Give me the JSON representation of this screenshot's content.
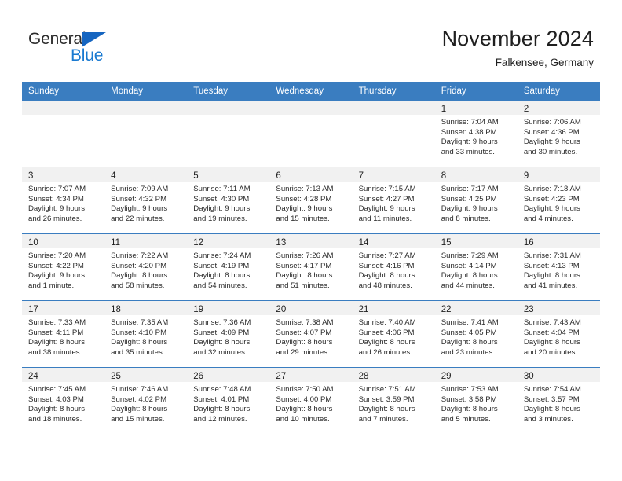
{
  "brand": {
    "name_part1": "General",
    "name_part2": "Blue",
    "accent_color": "#1a7ad1",
    "triangle_color": "#1565c0"
  },
  "header": {
    "month_title": "November 2024",
    "location": "Falkensee, Germany",
    "header_bg_color": "#3a7dc0"
  },
  "weekday_headers": [
    "Sunday",
    "Monday",
    "Tuesday",
    "Wednesday",
    "Thursday",
    "Friday",
    "Saturday"
  ],
  "weeks": [
    [
      {
        "day": "",
        "sunrise": "",
        "sunset": "",
        "daylight_line1": "",
        "daylight_line2": "",
        "empty": true
      },
      {
        "day": "",
        "sunrise": "",
        "sunset": "",
        "daylight_line1": "",
        "daylight_line2": "",
        "empty": true
      },
      {
        "day": "",
        "sunrise": "",
        "sunset": "",
        "daylight_line1": "",
        "daylight_line2": "",
        "empty": true
      },
      {
        "day": "",
        "sunrise": "",
        "sunset": "",
        "daylight_line1": "",
        "daylight_line2": "",
        "empty": true
      },
      {
        "day": "",
        "sunrise": "",
        "sunset": "",
        "daylight_line1": "",
        "daylight_line2": "",
        "empty": true
      },
      {
        "day": "1",
        "sunrise": "Sunrise: 7:04 AM",
        "sunset": "Sunset: 4:38 PM",
        "daylight_line1": "Daylight: 9 hours",
        "daylight_line2": "and 33 minutes.",
        "empty": false
      },
      {
        "day": "2",
        "sunrise": "Sunrise: 7:06 AM",
        "sunset": "Sunset: 4:36 PM",
        "daylight_line1": "Daylight: 9 hours",
        "daylight_line2": "and 30 minutes.",
        "empty": false
      }
    ],
    [
      {
        "day": "3",
        "sunrise": "Sunrise: 7:07 AM",
        "sunset": "Sunset: 4:34 PM",
        "daylight_line1": "Daylight: 9 hours",
        "daylight_line2": "and 26 minutes.",
        "empty": false
      },
      {
        "day": "4",
        "sunrise": "Sunrise: 7:09 AM",
        "sunset": "Sunset: 4:32 PM",
        "daylight_line1": "Daylight: 9 hours",
        "daylight_line2": "and 22 minutes.",
        "empty": false
      },
      {
        "day": "5",
        "sunrise": "Sunrise: 7:11 AM",
        "sunset": "Sunset: 4:30 PM",
        "daylight_line1": "Daylight: 9 hours",
        "daylight_line2": "and 19 minutes.",
        "empty": false
      },
      {
        "day": "6",
        "sunrise": "Sunrise: 7:13 AM",
        "sunset": "Sunset: 4:28 PM",
        "daylight_line1": "Daylight: 9 hours",
        "daylight_line2": "and 15 minutes.",
        "empty": false
      },
      {
        "day": "7",
        "sunrise": "Sunrise: 7:15 AM",
        "sunset": "Sunset: 4:27 PM",
        "daylight_line1": "Daylight: 9 hours",
        "daylight_line2": "and 11 minutes.",
        "empty": false
      },
      {
        "day": "8",
        "sunrise": "Sunrise: 7:17 AM",
        "sunset": "Sunset: 4:25 PM",
        "daylight_line1": "Daylight: 9 hours",
        "daylight_line2": "and 8 minutes.",
        "empty": false
      },
      {
        "day": "9",
        "sunrise": "Sunrise: 7:18 AM",
        "sunset": "Sunset: 4:23 PM",
        "daylight_line1": "Daylight: 9 hours",
        "daylight_line2": "and 4 minutes.",
        "empty": false
      }
    ],
    [
      {
        "day": "10",
        "sunrise": "Sunrise: 7:20 AM",
        "sunset": "Sunset: 4:22 PM",
        "daylight_line1": "Daylight: 9 hours",
        "daylight_line2": "and 1 minute.",
        "empty": false
      },
      {
        "day": "11",
        "sunrise": "Sunrise: 7:22 AM",
        "sunset": "Sunset: 4:20 PM",
        "daylight_line1": "Daylight: 8 hours",
        "daylight_line2": "and 58 minutes.",
        "empty": false
      },
      {
        "day": "12",
        "sunrise": "Sunrise: 7:24 AM",
        "sunset": "Sunset: 4:19 PM",
        "daylight_line1": "Daylight: 8 hours",
        "daylight_line2": "and 54 minutes.",
        "empty": false
      },
      {
        "day": "13",
        "sunrise": "Sunrise: 7:26 AM",
        "sunset": "Sunset: 4:17 PM",
        "daylight_line1": "Daylight: 8 hours",
        "daylight_line2": "and 51 minutes.",
        "empty": false
      },
      {
        "day": "14",
        "sunrise": "Sunrise: 7:27 AM",
        "sunset": "Sunset: 4:16 PM",
        "daylight_line1": "Daylight: 8 hours",
        "daylight_line2": "and 48 minutes.",
        "empty": false
      },
      {
        "day": "15",
        "sunrise": "Sunrise: 7:29 AM",
        "sunset": "Sunset: 4:14 PM",
        "daylight_line1": "Daylight: 8 hours",
        "daylight_line2": "and 44 minutes.",
        "empty": false
      },
      {
        "day": "16",
        "sunrise": "Sunrise: 7:31 AM",
        "sunset": "Sunset: 4:13 PM",
        "daylight_line1": "Daylight: 8 hours",
        "daylight_line2": "and 41 minutes.",
        "empty": false
      }
    ],
    [
      {
        "day": "17",
        "sunrise": "Sunrise: 7:33 AM",
        "sunset": "Sunset: 4:11 PM",
        "daylight_line1": "Daylight: 8 hours",
        "daylight_line2": "and 38 minutes.",
        "empty": false
      },
      {
        "day": "18",
        "sunrise": "Sunrise: 7:35 AM",
        "sunset": "Sunset: 4:10 PM",
        "daylight_line1": "Daylight: 8 hours",
        "daylight_line2": "and 35 minutes.",
        "empty": false
      },
      {
        "day": "19",
        "sunrise": "Sunrise: 7:36 AM",
        "sunset": "Sunset: 4:09 PM",
        "daylight_line1": "Daylight: 8 hours",
        "daylight_line2": "and 32 minutes.",
        "empty": false
      },
      {
        "day": "20",
        "sunrise": "Sunrise: 7:38 AM",
        "sunset": "Sunset: 4:07 PM",
        "daylight_line1": "Daylight: 8 hours",
        "daylight_line2": "and 29 minutes.",
        "empty": false
      },
      {
        "day": "21",
        "sunrise": "Sunrise: 7:40 AM",
        "sunset": "Sunset: 4:06 PM",
        "daylight_line1": "Daylight: 8 hours",
        "daylight_line2": "and 26 minutes.",
        "empty": false
      },
      {
        "day": "22",
        "sunrise": "Sunrise: 7:41 AM",
        "sunset": "Sunset: 4:05 PM",
        "daylight_line1": "Daylight: 8 hours",
        "daylight_line2": "and 23 minutes.",
        "empty": false
      },
      {
        "day": "23",
        "sunrise": "Sunrise: 7:43 AM",
        "sunset": "Sunset: 4:04 PM",
        "daylight_line1": "Daylight: 8 hours",
        "daylight_line2": "and 20 minutes.",
        "empty": false
      }
    ],
    [
      {
        "day": "24",
        "sunrise": "Sunrise: 7:45 AM",
        "sunset": "Sunset: 4:03 PM",
        "daylight_line1": "Daylight: 8 hours",
        "daylight_line2": "and 18 minutes.",
        "empty": false
      },
      {
        "day": "25",
        "sunrise": "Sunrise: 7:46 AM",
        "sunset": "Sunset: 4:02 PM",
        "daylight_line1": "Daylight: 8 hours",
        "daylight_line2": "and 15 minutes.",
        "empty": false
      },
      {
        "day": "26",
        "sunrise": "Sunrise: 7:48 AM",
        "sunset": "Sunset: 4:01 PM",
        "daylight_line1": "Daylight: 8 hours",
        "daylight_line2": "and 12 minutes.",
        "empty": false
      },
      {
        "day": "27",
        "sunrise": "Sunrise: 7:50 AM",
        "sunset": "Sunset: 4:00 PM",
        "daylight_line1": "Daylight: 8 hours",
        "daylight_line2": "and 10 minutes.",
        "empty": false
      },
      {
        "day": "28",
        "sunrise": "Sunrise: 7:51 AM",
        "sunset": "Sunset: 3:59 PM",
        "daylight_line1": "Daylight: 8 hours",
        "daylight_line2": "and 7 minutes.",
        "empty": false
      },
      {
        "day": "29",
        "sunrise": "Sunrise: 7:53 AM",
        "sunset": "Sunset: 3:58 PM",
        "daylight_line1": "Daylight: 8 hours",
        "daylight_line2": "and 5 minutes.",
        "empty": false
      },
      {
        "day": "30",
        "sunrise": "Sunrise: 7:54 AM",
        "sunset": "Sunset: 3:57 PM",
        "daylight_line1": "Daylight: 8 hours",
        "daylight_line2": "and 3 minutes.",
        "empty": false
      }
    ]
  ]
}
